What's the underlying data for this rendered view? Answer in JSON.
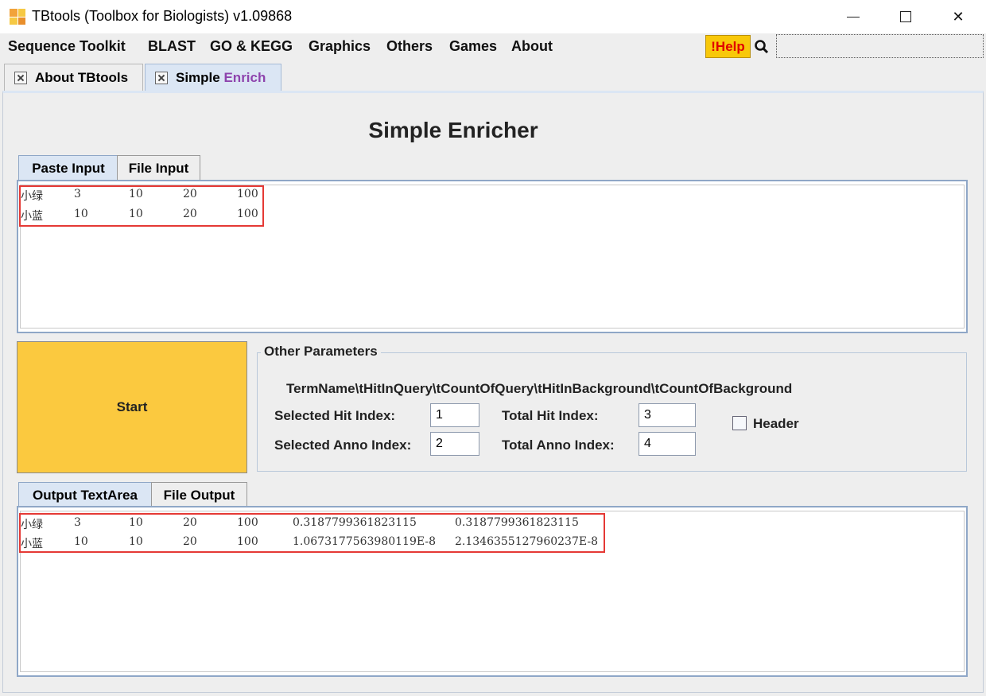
{
  "window": {
    "title": "TBtools (Toolbox for Biologists) v1.09868",
    "app_icon": "tbtools-icon"
  },
  "menu": {
    "items": [
      "Sequence Toolkit",
      "BLAST",
      "GO & KEGG",
      "Graphics",
      "Others",
      "Games",
      "About"
    ],
    "help_label": "!Help",
    "search_placeholder": ""
  },
  "doc_tabs": [
    {
      "label": "About TBtools",
      "active": false
    },
    {
      "label_plain": "Simple ",
      "label_colored": "Enrich",
      "active": true
    }
  ],
  "page_title": "Simple Enricher",
  "input_tabs": [
    "Paste Input",
    "File Input"
  ],
  "input_rows": [
    [
      "小绿",
      "3",
      "10",
      "20",
      "100"
    ],
    [
      "小蓝",
      "10",
      "10",
      "20",
      "100"
    ]
  ],
  "start_label": "Start",
  "params": {
    "legend": "Other Parameters",
    "format": "TermName\\tHitInQuery\\tCountOfQuery\\tHitInBackground\\tCountOfBackground",
    "selected_hit_label": "Selected Hit Index:",
    "selected_hit_value": "1",
    "selected_anno_label": "Selected Anno Index:",
    "selected_anno_value": "2",
    "total_hit_label": "Total Hit Index:",
    "total_hit_value": "3",
    "total_anno_label": "Total Anno Index:",
    "total_anno_value": "4",
    "header_label": "Header",
    "header_checked": false
  },
  "output_tabs": [
    "Output TextArea",
    "File Output"
  ],
  "output_rows": [
    [
      "小绿",
      "3",
      "10",
      "20",
      "100",
      "0.3187799361823115",
      "0.3187799361823115"
    ],
    [
      "小蓝",
      "10",
      "10",
      "20",
      "100",
      "1.0673177563980119E-8",
      "2.1346355127960237E-8"
    ]
  ],
  "colors": {
    "start_button": "#fbc93f",
    "help_button": "#f8c80a",
    "highlight_box": "#e53935",
    "active_tab": "#dbe6f4"
  }
}
